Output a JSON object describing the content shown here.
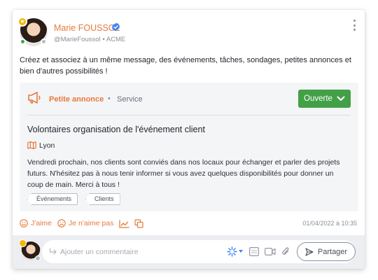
{
  "post": {
    "author_name": "Marie FOUSSOL",
    "author_handle": "@MarieFoussol",
    "author_company": "ACME",
    "sub_separator": "•",
    "text": "Créez et associez à un même message, des événements, tâches, sondages, petites annonces et bien d'autres possibilités !"
  },
  "ad": {
    "type": "Petite annonce",
    "separator": "•",
    "category": "Service",
    "status_label": "Ouverte",
    "title": "Volontaires organisation de l'événement client",
    "location": "Lyon",
    "description": "Vendredi prochain, nos clients sont conviés dans nos locaux pour échanger et parler des projets futurs.  N'hésitez pas à nous tenir informer si vous avez quelques disponibilités pour donner un coup de main. Merci à tous !",
    "tags": [
      "Événements",
      "Clients"
    ]
  },
  "actions": {
    "like_label": "J'aime",
    "dislike_label": "Je n'aime pas",
    "timestamp": "01/04/2022 à 10:35"
  },
  "comment": {
    "placeholder": "Ajouter un commentaire",
    "share_label": "Partager"
  },
  "colors": {
    "accent": "#e8793a",
    "status_open": "#43a047",
    "verified": "#3b82f6",
    "online": "#39a84a"
  }
}
